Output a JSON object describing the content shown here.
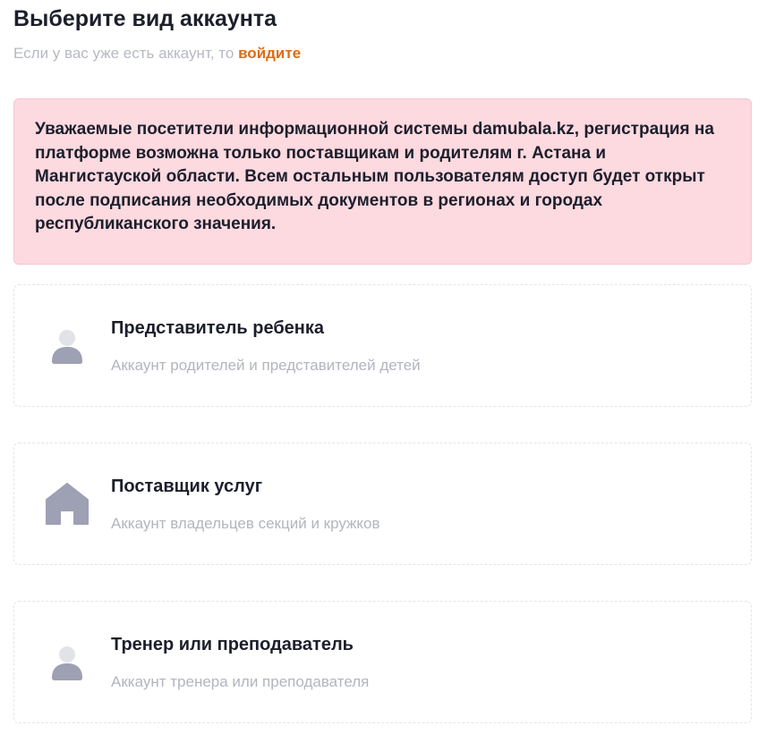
{
  "header": {
    "title": "Выберите вид аккаунта",
    "subtitle_prefix": "Если у вас уже есть аккаунт, то",
    "login_link": "войдите"
  },
  "notice": {
    "text": "Уважаемые посетители информационной системы damubala.kz, регистрация на платформе возможна только поставщикам и родителям г. Астана и Мангистауской области. Всем остальным пользователям доступ будет открыт после подписания необходимых документов в регионах и городах республиканского значения."
  },
  "colors": {
    "accent": "#e06b12",
    "notice_bg": "#fdd9e0",
    "icon_head": "#e2e3e8",
    "icon_body": "#9ea0b3"
  },
  "account_types": [
    {
      "icon": "person-icon",
      "title": "Представитель ребенка",
      "description": "Аккаунт родителей и представителей детей"
    },
    {
      "icon": "house-icon",
      "title": "Поставщик услуг",
      "description": "Аккаунт владельцев секций и кружков"
    },
    {
      "icon": "person-icon",
      "title": "Тренер или преподаватель",
      "description": "Аккаунт тренера или преподавателя"
    }
  ]
}
